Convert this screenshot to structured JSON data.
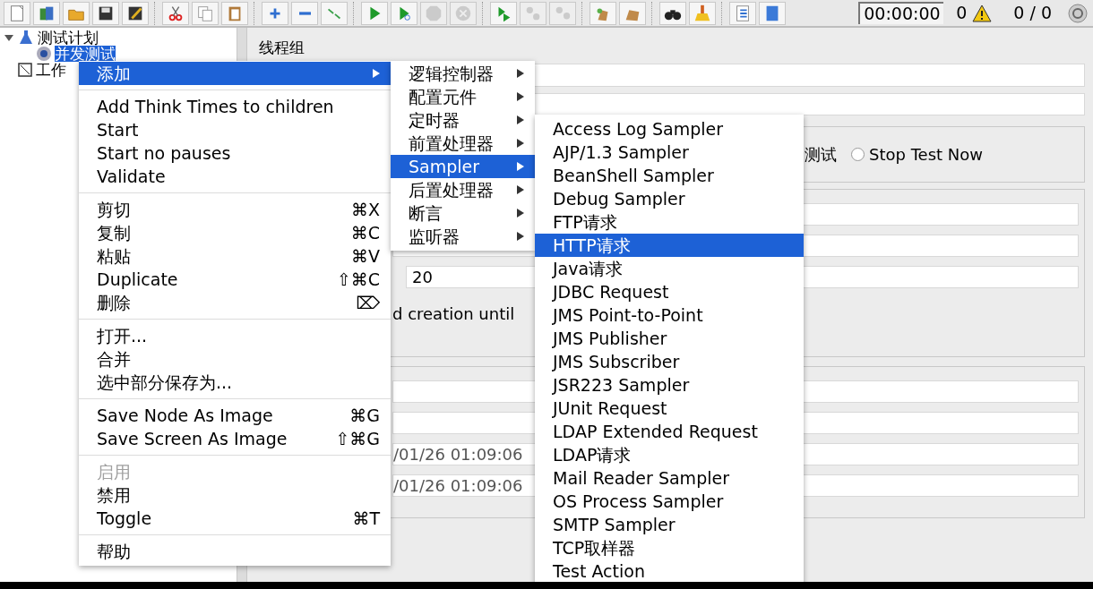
{
  "toolbar": {
    "groups": [
      [
        {
          "disabled": false
        },
        {
          "disabled": false
        },
        {
          "disabled": false
        },
        {
          "disabled": false
        },
        {
          "disabled": false
        }
      ],
      [
        {
          "disabled": false
        },
        {
          "disabled": false
        },
        {
          "disabled": false
        }
      ],
      [
        {
          "disabled": false
        },
        {
          "disabled": false
        },
        {
          "disabled": false
        }
      ],
      [
        {
          "disabled": false
        },
        {
          "disabled": false
        },
        {
          "disabled": true
        },
        {
          "disabled": true
        }
      ],
      [
        {
          "disabled": false
        },
        {
          "disabled": true
        },
        {
          "disabled": true
        }
      ],
      [
        {
          "disabled": false
        },
        {
          "disabled": false
        }
      ],
      [
        {
          "disabled": false
        },
        {
          "disabled": false
        }
      ],
      [
        {
          "disabled": false
        },
        {
          "disabled": false
        }
      ]
    ],
    "timer": "00:00:00",
    "error_count": "0",
    "threads": "0 / 0"
  },
  "tree": [
    {
      "label": "测试计划",
      "expanded": true,
      "selected": false,
      "children": [
        {
          "label": "并发测试",
          "selected": true
        }
      ]
    },
    {
      "label": "工作",
      "selected": false
    }
  ],
  "panel": {
    "title": "线程组",
    "on_error": {
      "partial_label": "测试",
      "option": {
        "label": "Stop Test Now",
        "selected": false
      }
    },
    "thread_properties": {
      "loop_count": "20",
      "partial_text": "d creation until"
    },
    "scheduler": {
      "start_time": "/01/26 01:09:06",
      "end_time": "/01/26 01:09:06"
    }
  },
  "context_menu": {
    "items": [
      {
        "kind": "item",
        "label": "添加",
        "submenu": true,
        "selected": true,
        "disabled": false
      },
      {
        "kind": "separator"
      },
      {
        "kind": "item",
        "label": "Add Think Times to children",
        "selected": false,
        "disabled": false
      },
      {
        "kind": "item",
        "label": "Start",
        "selected": false,
        "disabled": false
      },
      {
        "kind": "item",
        "label": "Start no pauses",
        "selected": false,
        "disabled": false
      },
      {
        "kind": "item",
        "label": "Validate",
        "selected": false,
        "disabled": false
      },
      {
        "kind": "separator"
      },
      {
        "kind": "item",
        "label": "剪切",
        "shortcut": "⌘X",
        "selected": false,
        "disabled": false
      },
      {
        "kind": "item",
        "label": "复制",
        "shortcut": "⌘C",
        "selected": false,
        "disabled": false
      },
      {
        "kind": "item",
        "label": "粘贴",
        "shortcut": "⌘V",
        "selected": false,
        "disabled": false
      },
      {
        "kind": "item",
        "label": "Duplicate",
        "shortcut": "⇧⌘C",
        "selected": false,
        "disabled": false
      },
      {
        "kind": "item",
        "label": "删除",
        "shortcut": "⌦",
        "selected": false,
        "disabled": false
      },
      {
        "kind": "separator"
      },
      {
        "kind": "item",
        "label": "打开...",
        "selected": false,
        "disabled": false
      },
      {
        "kind": "item",
        "label": "合并",
        "selected": false,
        "disabled": false
      },
      {
        "kind": "item",
        "label": "选中部分保存为...",
        "selected": false,
        "disabled": false
      },
      {
        "kind": "separator"
      },
      {
        "kind": "item",
        "label": "Save Node As Image",
        "shortcut": "⌘G",
        "selected": false,
        "disabled": false
      },
      {
        "kind": "item",
        "label": "Save Screen As Image",
        "shortcut": "⇧⌘G",
        "selected": false,
        "disabled": false
      },
      {
        "kind": "separator"
      },
      {
        "kind": "item",
        "label": "启用",
        "selected": false,
        "disabled": true
      },
      {
        "kind": "item",
        "label": "禁用",
        "selected": false,
        "disabled": false
      },
      {
        "kind": "item",
        "label": "Toggle",
        "shortcut": "⌘T",
        "selected": false,
        "disabled": false
      },
      {
        "kind": "separator"
      },
      {
        "kind": "item",
        "label": "帮助",
        "selected": false,
        "disabled": false
      }
    ]
  },
  "add_menu": {
    "items": [
      {
        "label": "逻辑控制器",
        "selected": false
      },
      {
        "label": "配置元件",
        "selected": false
      },
      {
        "label": "定时器",
        "selected": false
      },
      {
        "label": "前置处理器",
        "selected": false
      },
      {
        "label": "Sampler",
        "selected": true
      },
      {
        "label": "后置处理器",
        "selected": false
      },
      {
        "label": "断言",
        "selected": false
      },
      {
        "label": "监听器",
        "selected": false
      }
    ]
  },
  "sampler_menu": {
    "items": [
      {
        "label": "Access Log Sampler",
        "selected": false
      },
      {
        "label": "AJP/1.3 Sampler",
        "selected": false
      },
      {
        "label": "BeanShell Sampler",
        "selected": false
      },
      {
        "label": "Debug Sampler",
        "selected": false
      },
      {
        "label": "FTP请求",
        "selected": false
      },
      {
        "label": "HTTP请求",
        "selected": true
      },
      {
        "label": "Java请求",
        "selected": false
      },
      {
        "label": "JDBC Request",
        "selected": false
      },
      {
        "label": "JMS Point-to-Point",
        "selected": false
      },
      {
        "label": "JMS Publisher",
        "selected": false
      },
      {
        "label": "JMS Subscriber",
        "selected": false
      },
      {
        "label": "JSR223 Sampler",
        "selected": false
      },
      {
        "label": "JUnit Request",
        "selected": false
      },
      {
        "label": "LDAP Extended Request",
        "selected": false
      },
      {
        "label": "LDAP请求",
        "selected": false
      },
      {
        "label": "Mail Reader Sampler",
        "selected": false
      },
      {
        "label": "OS Process Sampler",
        "selected": false
      },
      {
        "label": "SMTP Sampler",
        "selected": false
      },
      {
        "label": "TCP取样器",
        "selected": false
      },
      {
        "label": "Test Action",
        "selected": false
      }
    ]
  }
}
